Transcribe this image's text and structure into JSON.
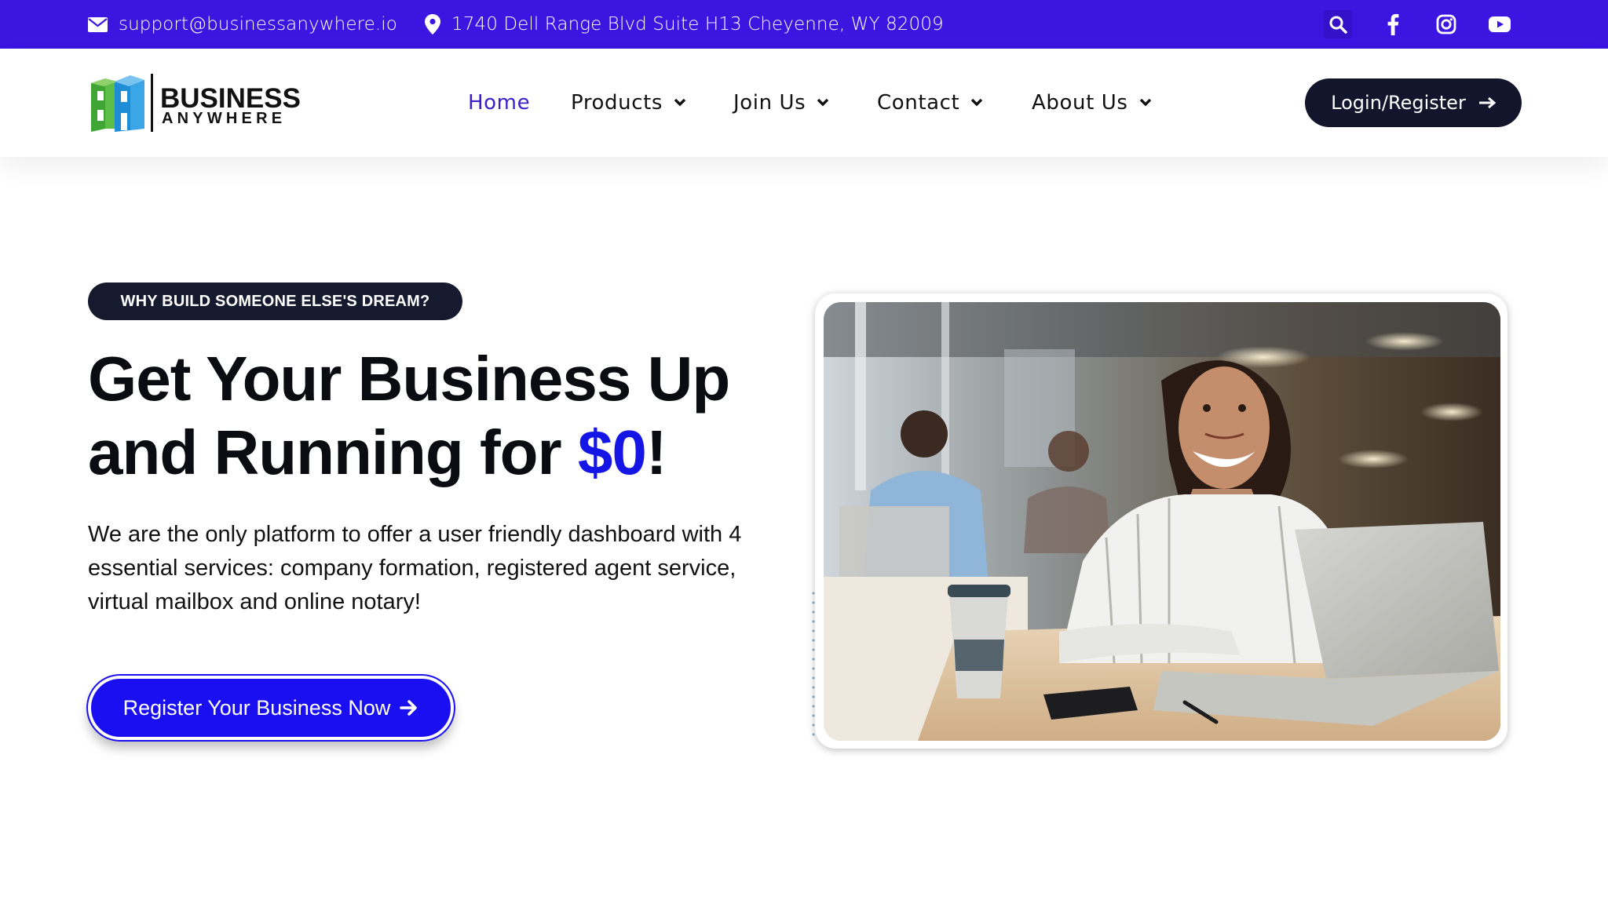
{
  "topbar": {
    "email": "support@businessanywhere.io",
    "address": "1740 Dell Range Blvd Suite H13 Cheyenne, WY 82009",
    "icons": [
      "envelope-icon",
      "map-pin-icon",
      "search-icon",
      "facebook-icon",
      "instagram-icon",
      "youtube-icon"
    ]
  },
  "brand": {
    "line1": "BUSINESS",
    "line2": "ANYWHERE",
    "mark_colors": [
      "#3fa535",
      "#1f8cd6",
      "#6bbf4e"
    ]
  },
  "nav": {
    "items": [
      {
        "label": "Home",
        "active": true,
        "has_dropdown": false
      },
      {
        "label": "Products",
        "active": false,
        "has_dropdown": true
      },
      {
        "label": "Join Us",
        "active": false,
        "has_dropdown": true
      },
      {
        "label": "Contact",
        "active": false,
        "has_dropdown": true
      },
      {
        "label": "About Us",
        "active": false,
        "has_dropdown": true
      }
    ],
    "login_label": "Login/Register"
  },
  "hero": {
    "eyebrow": "WHY BUILD SOMEONE ELSE'S DREAM?",
    "headline_line1": "Get Your Business Up",
    "headline_line2_prefix": "and Running for ",
    "headline_accent": "$0",
    "headline_suffix": "!",
    "description": "We are the only platform to offer a user friendly dashboard with 4 essential services: company formation, registered agent service, virtual mailbox and online notary!",
    "cta_label": "Register Your Business Now"
  },
  "colors": {
    "topbar": "#3c16e0",
    "accent": "#1515e6",
    "dark": "#12152b",
    "nav_active": "#3a1fc9"
  }
}
